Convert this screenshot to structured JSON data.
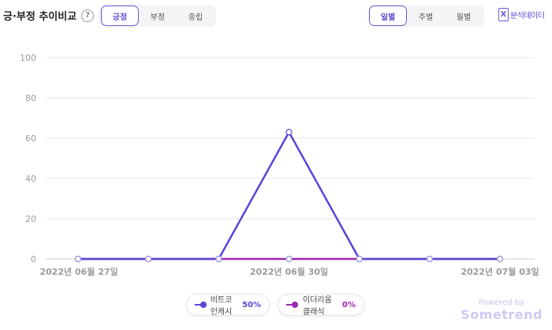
{
  "header": {
    "title": "긍·부정 추이비교",
    "help_glyph": "?",
    "sentiment_tabs": [
      {
        "label": "긍정",
        "active": true
      },
      {
        "label": "부정",
        "active": false
      },
      {
        "label": "중립",
        "active": false
      }
    ],
    "period_tabs": [
      {
        "label": "일별",
        "active": true
      },
      {
        "label": "주별",
        "active": false
      },
      {
        "label": "월별",
        "active": false
      }
    ],
    "export": {
      "icon": "excel-icon",
      "icon_glyph": "X",
      "label": "분석데이터"
    }
  },
  "chart_data": {
    "type": "line",
    "x": [
      "2022-06-27",
      "2022-06-28",
      "2022-06-29",
      "2022-06-30",
      "2022-07-01",
      "2022-07-02",
      "2022-07-03"
    ],
    "x_tick_labels": [
      "2022년 06월 27일",
      "2022년 06월 30일",
      "2022년 07월 03일"
    ],
    "ylim": [
      0,
      100
    ],
    "y_ticks": [
      0,
      20,
      40,
      60,
      80,
      100
    ],
    "grid": true,
    "legend_position": "bottom",
    "series": [
      {
        "name": "비트코인캐시",
        "values": [
          0,
          0,
          0,
          63,
          0,
          0,
          0
        ],
        "color": "#5a45d6"
      },
      {
        "name": "이더리움클래식",
        "values": [
          0,
          0,
          0,
          0,
          0,
          0,
          0
        ],
        "color": "#9c27b0"
      }
    ]
  },
  "legend": [
    {
      "name": "비트코인캐시",
      "pct": "50%",
      "color": "#5a45d6"
    },
    {
      "name": "이더리움클래식",
      "pct": "0%",
      "color": "#9c27b0"
    }
  ],
  "branding": {
    "line1": "Powered by",
    "line2": "Sometrend"
  }
}
